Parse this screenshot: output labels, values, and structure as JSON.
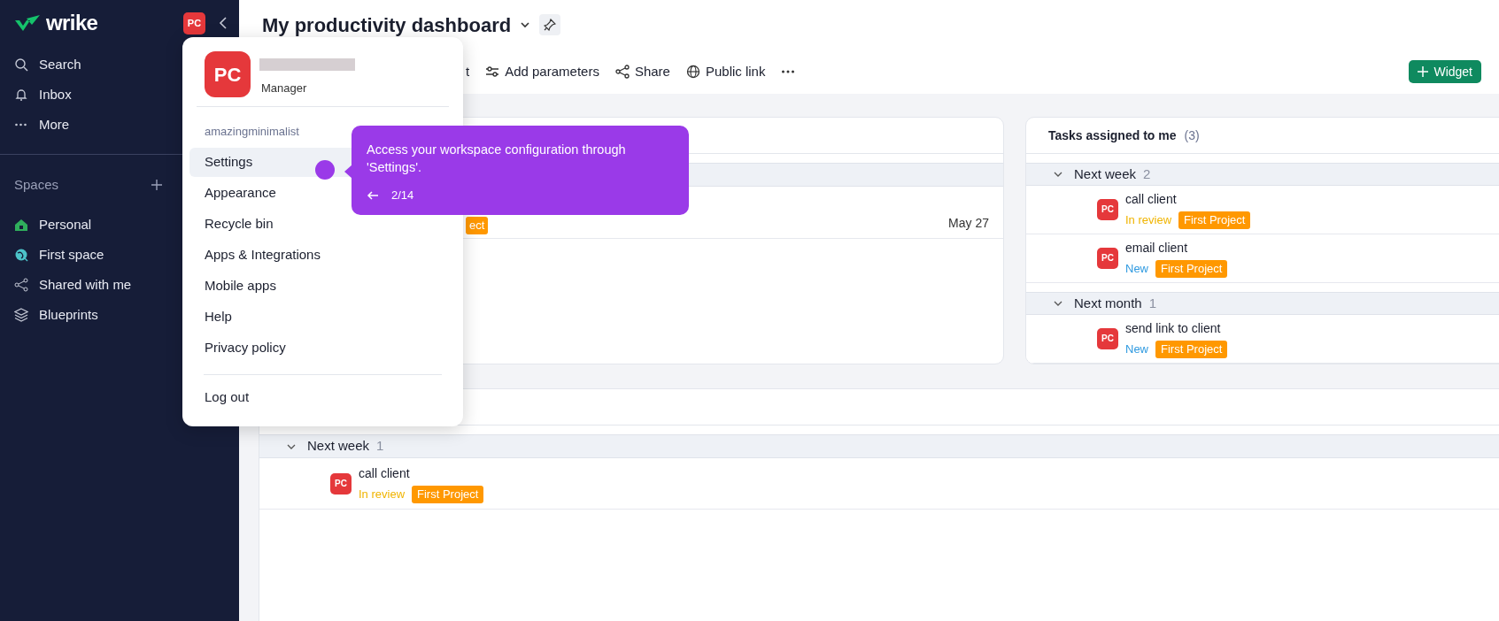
{
  "sidebar": {
    "logo": "wrike",
    "avatar": "PC",
    "nav": [
      {
        "label": "Search"
      },
      {
        "label": "Inbox"
      },
      {
        "label": "More"
      }
    ],
    "spaces_header": "Spaces",
    "spaces": [
      {
        "label": "Personal"
      },
      {
        "label": "First space"
      },
      {
        "label": "Shared with me"
      },
      {
        "label": "Blueprints"
      }
    ]
  },
  "header": {
    "title": "My productivity dashboard",
    "toolbar": [
      "t",
      "Add parameters",
      "Share",
      "Public link"
    ],
    "widget_button": "Widget"
  },
  "left_widget": {
    "tag": "ect",
    "date": "May 27"
  },
  "tasks_widget": {
    "title": "Tasks assigned to me",
    "count": "(3)",
    "groups": [
      {
        "label": "Next week",
        "count": "2",
        "expanded": true,
        "tasks": [
          {
            "name": "call client",
            "avatar": "PC",
            "status": "In review",
            "kind": "review",
            "project": "First Project"
          },
          {
            "name": "email client",
            "avatar": "PC",
            "status": "New",
            "kind": "new",
            "project": "First Project"
          }
        ]
      },
      {
        "label": "Next month",
        "count": "1",
        "expanded": true,
        "tasks": [
          {
            "name": "send link to client",
            "avatar": "PC",
            "status": "New",
            "kind": "new",
            "project": "First Project"
          }
        ]
      }
    ]
  },
  "bottom_widget": {
    "groups": [
      {
        "label": "Next week",
        "count": "1",
        "expanded": true,
        "tasks": [
          {
            "name": "call client",
            "avatar": "PC",
            "status": "In review",
            "kind": "review",
            "project": "First Project"
          }
        ]
      }
    ]
  },
  "user_menu": {
    "avatar": "PC",
    "role": "Manager",
    "account": "amazingminimalist",
    "items": [
      {
        "label": "Settings",
        "selected": true
      },
      {
        "label": "Appearance",
        "selected": false
      },
      {
        "label": "Recycle bin",
        "selected": false
      },
      {
        "label": "Apps & Integrations",
        "selected": false
      },
      {
        "label": "Mobile apps",
        "selected": false
      },
      {
        "label": "Help",
        "selected": false
      },
      {
        "label": "Privacy policy",
        "selected": false
      }
    ],
    "logout": "Log out"
  },
  "tooltip": {
    "text": "Access your workspace configuration through 'Settings'.",
    "step": "2/14"
  }
}
